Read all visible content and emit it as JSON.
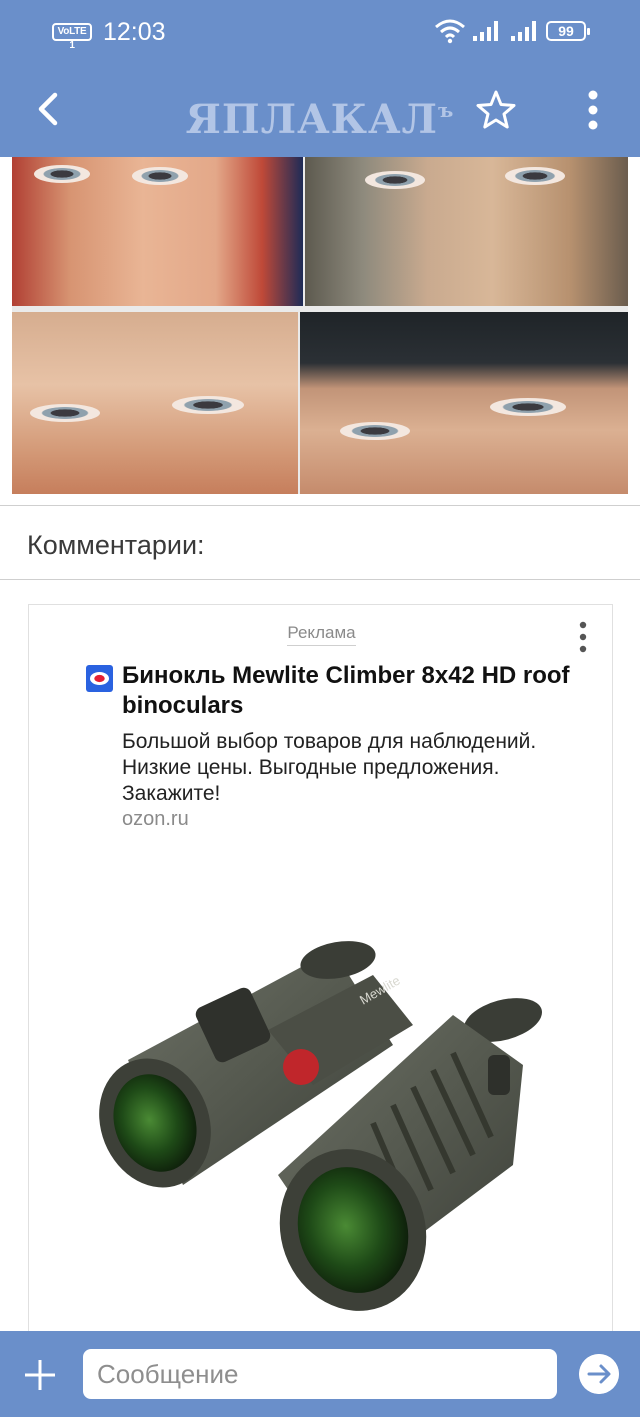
{
  "status_bar": {
    "network_badge": "VoLTE 1",
    "time": "12:03",
    "battery": "99"
  },
  "header": {
    "logo_text": "ЯПЛАКАЛ",
    "logo_suffix": "ъ",
    "icons": [
      "back-arrow",
      "star-outline",
      "more-vertical"
    ],
    "brand_color": "#6a8fca"
  },
  "post": {
    "image_icons": [
      "portrait-photo",
      "portrait-photo",
      "portrait-photo",
      "portrait-photo"
    ]
  },
  "comments": {
    "title": "Комментарии:"
  },
  "ad": {
    "label": "Реклама",
    "title": "Бинокль Mewlite Climber 8x42 HD roof binoculars",
    "description": "Большой выбор товаров для наблюдений. Низкие цены. Выгодные предложения. Закажите!",
    "domain": "ozon.ru",
    "image_brand_text": "Mewlite",
    "advertiser_icon": "ozon-logo"
  },
  "composer": {
    "placeholder": "Сообщение",
    "icons": [
      "plus",
      "send-arrow"
    ]
  }
}
